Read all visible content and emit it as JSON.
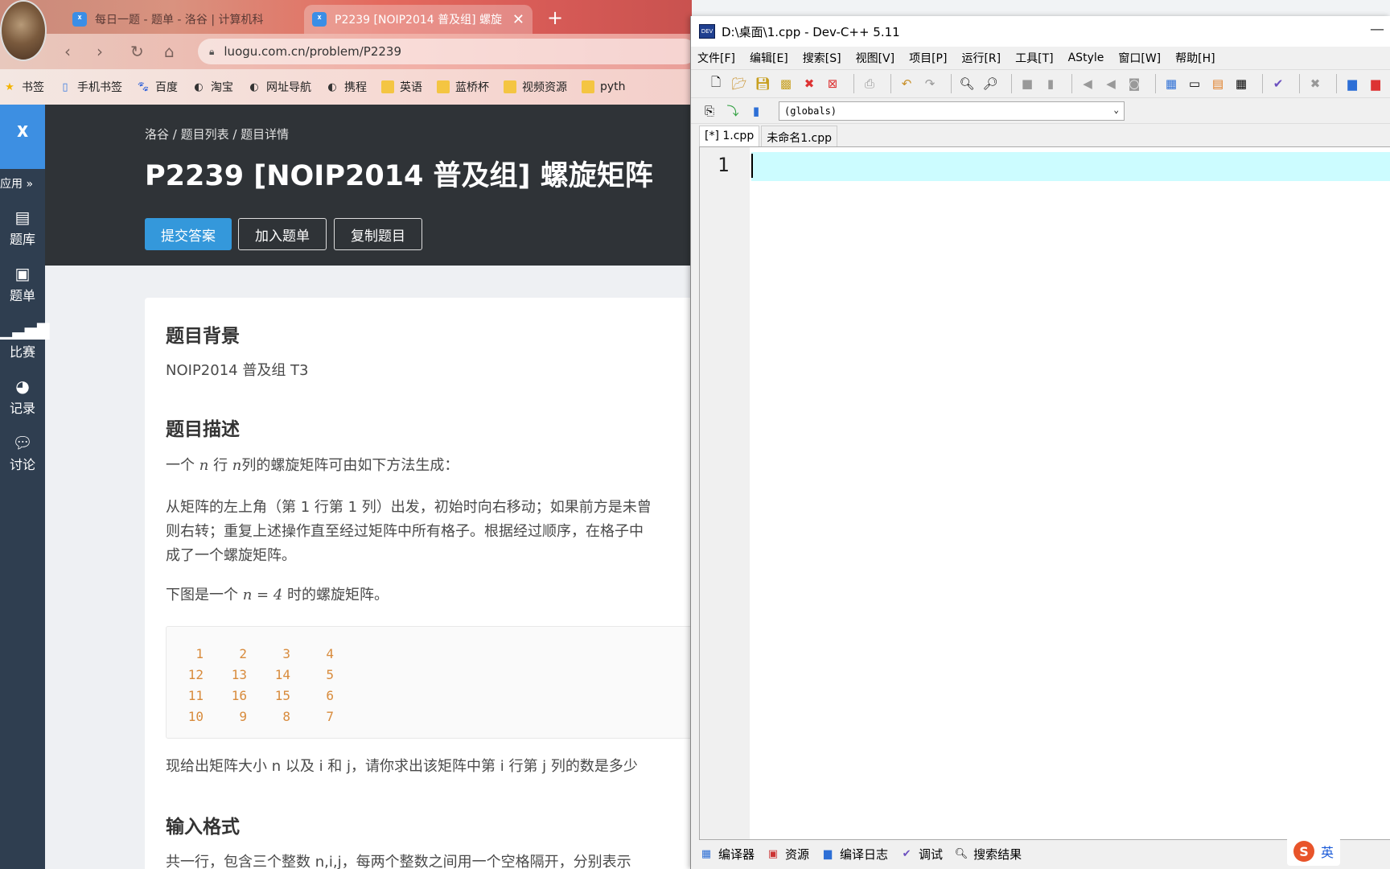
{
  "browser": {
    "tabs": [
      {
        "title": "每日一题 - 题单 - 洛谷 | 计算机科"
      },
      {
        "title": "P2239 [NOIP2014 普及组] 螺旋"
      }
    ],
    "url": "luogu.com.cn/problem/P2239",
    "bookmarks": [
      "书签",
      "手机书签",
      "百度",
      "淘宝",
      "网址导航",
      "携程",
      "英语",
      "蓝桥杯",
      "视频资源",
      "pyth"
    ]
  },
  "luogu": {
    "logo": "⟨",
    "sidebar": {
      "apps": "应用 »",
      "items": [
        "题库",
        "题单",
        "比赛",
        "记录",
        "讨论"
      ]
    },
    "breadcrumb": "洛谷 / 题目列表 / 题目详情",
    "title": "P2239 [NOIP2014 普及组] 螺旋矩阵",
    "buttons": {
      "submit": "提交答案",
      "add_to_list": "加入题单",
      "copy": "复制题目"
    },
    "background_heading": "题目背景",
    "background_text": "NOIP2014 普及组 T3",
    "description_heading": "题目描述",
    "desc_line1_a": "一个",
    "desc_line1_n1": "n",
    "desc_line1_b": "行",
    "desc_line1_n2": "n",
    "desc_line1_c": "列的螺旋矩阵可由如下方法生成：",
    "desc_p2_l1": "从矩阵的左上角（第 1 行第 1 列）出发，初始时向右移动；如果前方是未曾",
    "desc_p2_l2": "则右转；重复上述操作直至经过矩阵中所有格子。根据经过顺序，在格子中",
    "desc_p2_l3": "成了一个螺旋矩阵。",
    "desc_p3_a": "下图是一个",
    "desc_p3_math": "n = 4",
    "desc_p3_b": "时的螺旋矩阵。",
    "matrix": [
      [
        "1",
        "2",
        "3",
        "4"
      ],
      [
        "12",
        "13",
        "14",
        "5"
      ],
      [
        "11",
        "16",
        "15",
        "6"
      ],
      [
        "10",
        "9",
        "8",
        "7"
      ]
    ],
    "desc_p4": "现给出矩阵大小 n 以及 i 和 j，请你求出该矩阵中第 i 行第 j 列的数是多少",
    "input_heading": "输入格式",
    "input_text": "共一行，包含三个整数 n,i,j，每两个整数之间用一个空格隔开，分别表示"
  },
  "devcpp": {
    "title": "D:\\桌面\\1.cpp - Dev-C++ 5.11",
    "menu": [
      "文件[F]",
      "编辑[E]",
      "搜索[S]",
      "视图[V]",
      "项目[P]",
      "运行[R]",
      "工具[T]",
      "AStyle",
      "窗口[W]",
      "帮助[H]"
    ],
    "scope_select": "(globals)",
    "editor_tabs": [
      "[*] 1.cpp",
      "未命名1.cpp"
    ],
    "line_number": "1",
    "bottom_tabs": [
      "编译器",
      "资源",
      "编译日志",
      "调试",
      "搜索结果"
    ]
  },
  "ime": {
    "lang": "英"
  }
}
